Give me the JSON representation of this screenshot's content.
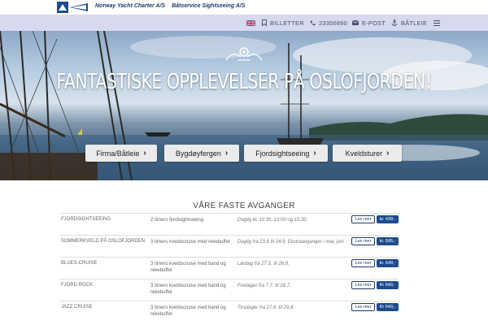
{
  "brand": {
    "company_1": "Norway Yacht Charter A/S",
    "company_2": "Båtservice Sightseeing A/S"
  },
  "nav": {
    "language_icon": "uk-flag-icon",
    "tickets": "BILLETTER",
    "phone": "23356890",
    "email": "E-POST",
    "boat_rental": "BÅTLEIE",
    "menu_icon": "hamburger-icon"
  },
  "hero": {
    "title": "FANTASTISKE OPPLEVELSER PÅ OSLOFJORDEN!",
    "buttons": [
      {
        "label": "Firma/Båtleie"
      },
      {
        "label": "Bygdøyfergen"
      },
      {
        "label": "Fjordsightseeing"
      },
      {
        "label": "Kveldsturer"
      }
    ]
  },
  "departures": {
    "title": "VÅRE FASTE AVGANGER",
    "more_label": "Les mer",
    "rows": [
      {
        "name": "FJORDSIGHTSEEING",
        "desc": "2 timers fjordsightseeing",
        "time": "Daglig kl. 10:30, 13:00 og 15:30",
        "price": "kr. 439,-"
      },
      {
        "name": "SOMMERKVELD PÅ OSLOFJORDEN",
        "desc": "3 timers kveldscruise med rekebuffet",
        "time": "Daglig fra 23.6 til 24.9; Ekstraavganger i mai, juni",
        "price": "kr. 595,-"
      },
      {
        "name": "BLUES-CRUISE",
        "desc": "3 timers kveldscruise med band og rekebuffet",
        "time": "Lørdag fra 27.5. til 26.8.",
        "price": "kr. 649,-"
      },
      {
        "name": "FJORD ROCK",
        "desc": "3 timers kveldscruise med band og rekebuffet",
        "time": "Fredager fra 7.7. til 28.7.",
        "price": "Kr 649,-"
      },
      {
        "name": "JAZZ CRUISE",
        "desc": "3 timers kveldscruise med band og rekebuffet",
        "time": "Tirsdager fra 27.6. til 29.8.",
        "price": "Kr 649,-"
      }
    ]
  }
}
